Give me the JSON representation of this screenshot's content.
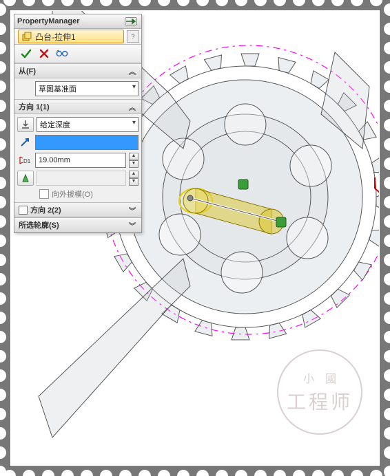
{
  "panel": {
    "title": "PropertyManager",
    "feature": {
      "name": "凸台-拉伸1",
      "help_tooltip": "?"
    },
    "actions": {
      "ok": "ok",
      "cancel": "cancel",
      "preview": "preview"
    },
    "from": {
      "header": "从(F)",
      "value": "草图基准面"
    },
    "dir1": {
      "header": "方向 1(1)",
      "end_condition": "给定深度",
      "selection": "",
      "depth": "19.00mm",
      "draft_check_label": "向外拔模(O)"
    },
    "dir2": {
      "header": "方向 2(2)"
    },
    "contours": {
      "header": "所选轮廓(S)"
    }
  },
  "watermark": {
    "line1": "小國",
    "line2": "工程师"
  }
}
